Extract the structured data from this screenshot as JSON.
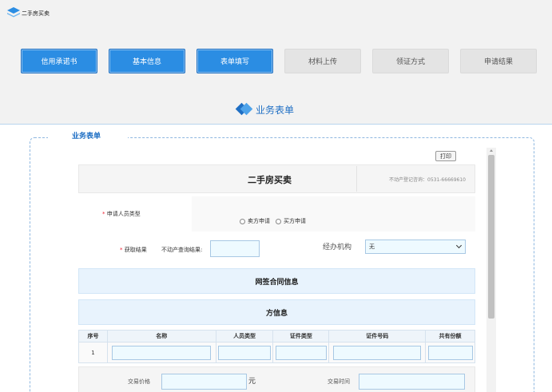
{
  "app": {
    "title": "二手房买卖",
    "accent": "#2b8de3"
  },
  "steps": [
    {
      "label": "信用承诺书",
      "active": true
    },
    {
      "label": "基本信息",
      "active": true
    },
    {
      "label": "表单填写",
      "active": true
    },
    {
      "label": "材料上传",
      "active": false
    },
    {
      "label": "领证方式",
      "active": false
    },
    {
      "label": "申请结果",
      "active": false
    }
  ],
  "section": {
    "title": "业务表单"
  },
  "panel": {
    "legend": "业务表单",
    "print_label": "打印"
  },
  "form": {
    "title": "二手房买卖",
    "reg_no": "不动产登记咨询：0531-66669610",
    "applicant_label": "申请人员类型",
    "radio_options": [
      "卖方申请",
      "买方申请"
    ],
    "result_label": "获取结果",
    "query_label": "不动产查询结果:",
    "query_value": "",
    "agency_label": "经办机构",
    "agency_value": "无",
    "contract_band": "网签合同信息",
    "party_band": "方信息",
    "table": {
      "headers": [
        "序号",
        "名称",
        "人员类型",
        "证件类型",
        "证件号码",
        "共有份额"
      ],
      "rows": [
        {
          "index": "1"
        }
      ]
    },
    "price_label": "交易价格",
    "price_unit": "元",
    "time_label": "交易时间"
  }
}
